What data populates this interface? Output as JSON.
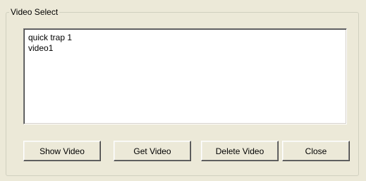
{
  "group": {
    "title": "Video Select"
  },
  "list": {
    "items": [
      {
        "label": "quick trap 1"
      },
      {
        "label": "video1"
      }
    ]
  },
  "buttons": {
    "show_video": "Show Video",
    "get_video": "Get Video",
    "delete_video": "Delete Video",
    "close": "Close"
  }
}
